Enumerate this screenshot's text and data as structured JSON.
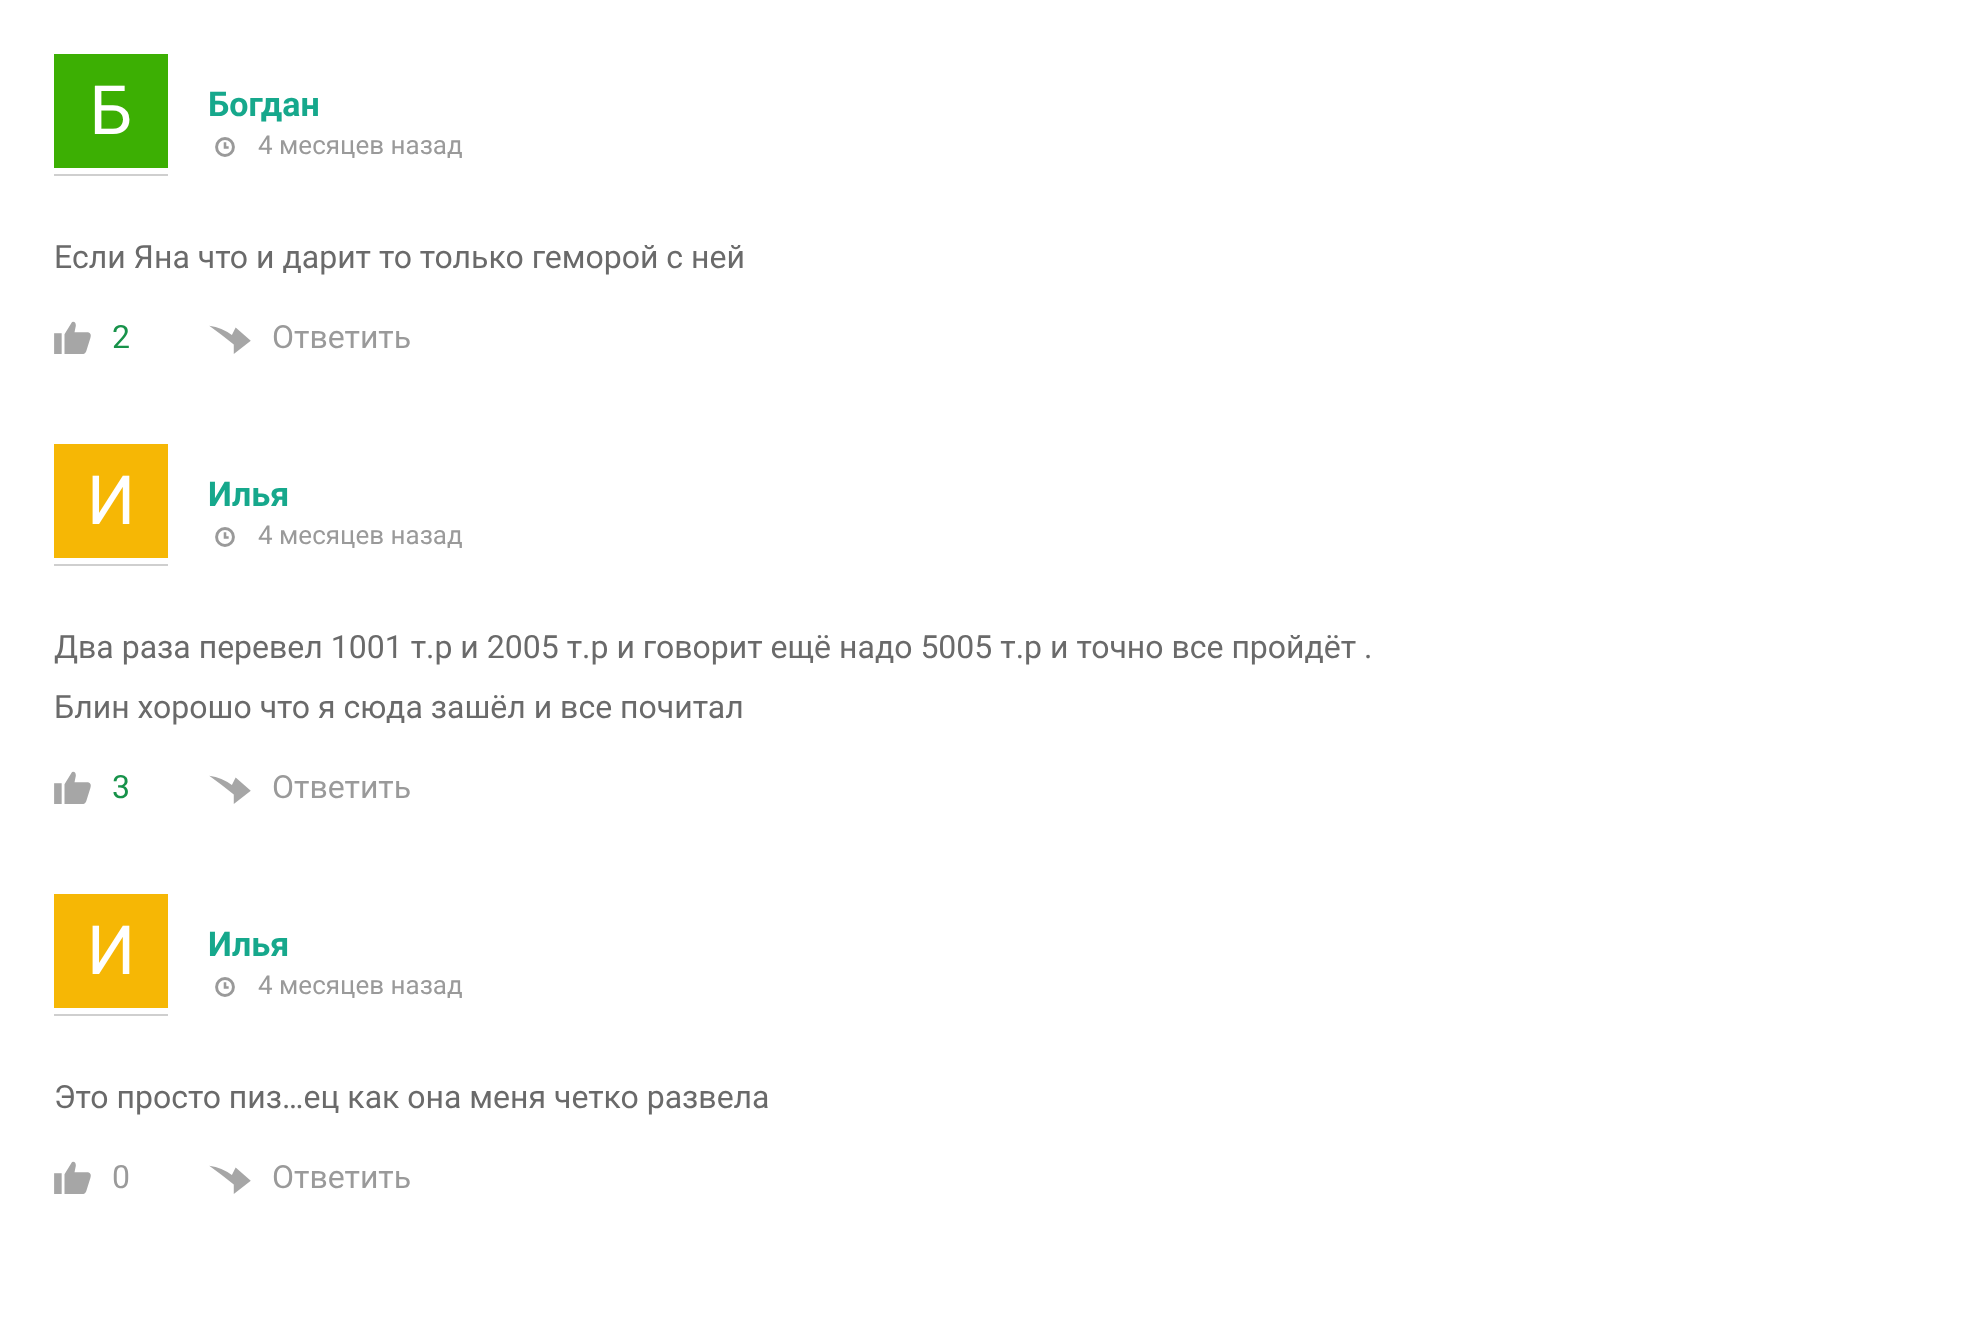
{
  "comments": [
    {
      "avatar_letter": "Б",
      "color": "#3caf03",
      "author": "Богдан",
      "time": "4 месяцев назад",
      "lines": [
        "Если Яна что и дарит то только геморой с ней"
      ],
      "votes": "2",
      "votes_positive": true,
      "reply": "Ответить"
    },
    {
      "avatar_letter": "И",
      "color": "#f6b705",
      "author": "Илья",
      "time": "4 месяцев назад",
      "lines": [
        "Два раза перевел 1001 т.р и 2005 т.р и говорит ещё надо 5005 т.р и точно все пройдёт .",
        "Блин хорошо что я сюда зашёл и все почитал"
      ],
      "votes": "3",
      "votes_positive": true,
      "reply": "Ответить"
    },
    {
      "avatar_letter": "И",
      "color": "#f6b705",
      "author": "Илья",
      "time": "4 месяцев назад",
      "lines": [
        "Это просто пиз…ец как она меня четко развела"
      ],
      "votes": "0",
      "votes_positive": false,
      "reply": "Ответить"
    }
  ]
}
